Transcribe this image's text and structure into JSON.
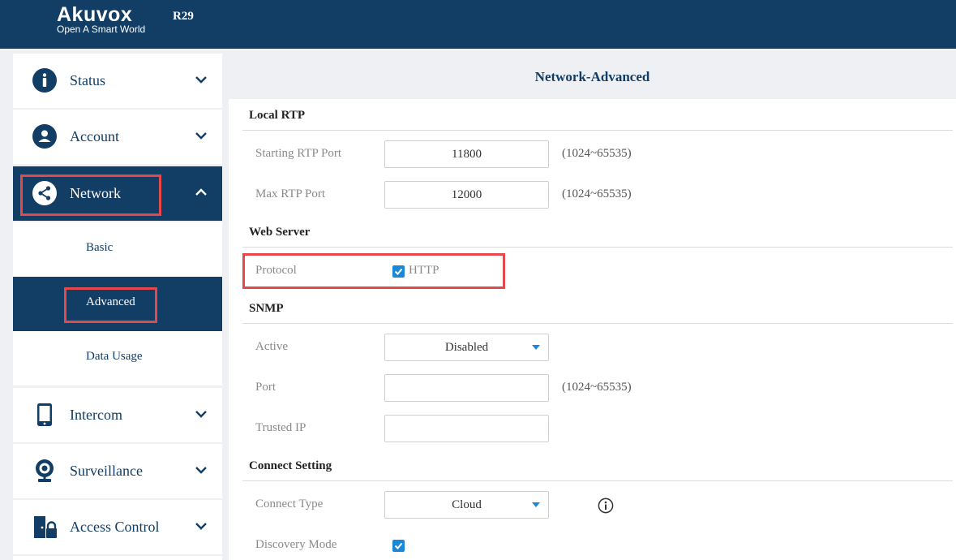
{
  "header": {
    "brand": "Akuvox",
    "tagline": "Open A Smart World",
    "model": "R29"
  },
  "sidebar": {
    "items": [
      {
        "label": "Status",
        "icon": "info-icon"
      },
      {
        "label": "Account",
        "icon": "user-icon"
      },
      {
        "label": "Network",
        "icon": "share-icon"
      },
      {
        "label": "Intercom",
        "icon": "phone-device-icon"
      },
      {
        "label": "Surveillance",
        "icon": "webcam-icon"
      },
      {
        "label": "Access Control",
        "icon": "door-lock-icon"
      }
    ],
    "network_sub": [
      "Basic",
      "Advanced",
      "Data Usage"
    ]
  },
  "main": {
    "title": "Network-Advanced",
    "local_rtp": {
      "heading": "Local RTP",
      "start_label": "Starting RTP Port",
      "start_value": "11800",
      "start_range": "(1024~65535)",
      "max_label": "Max RTP Port",
      "max_value": "12000",
      "max_range": "(1024~65535)"
    },
    "web_server": {
      "heading": "Web Server",
      "protocol_label": "Protocol",
      "http_label": "HTTP",
      "http_checked": true
    },
    "snmp": {
      "heading": "SNMP",
      "active_label": "Active",
      "active_value": "Disabled",
      "port_label": "Port",
      "port_value": "",
      "port_range": "(1024~65535)",
      "trusted_label": "Trusted IP",
      "trusted_value": ""
    },
    "connect": {
      "heading": "Connect Setting",
      "type_label": "Connect Type",
      "type_value": "Cloud",
      "discovery_label": "Discovery Mode",
      "discovery_checked": true
    }
  },
  "colors": {
    "primary": "#123d64",
    "accent": "#1a87d8",
    "highlight": "#e5474b"
  }
}
